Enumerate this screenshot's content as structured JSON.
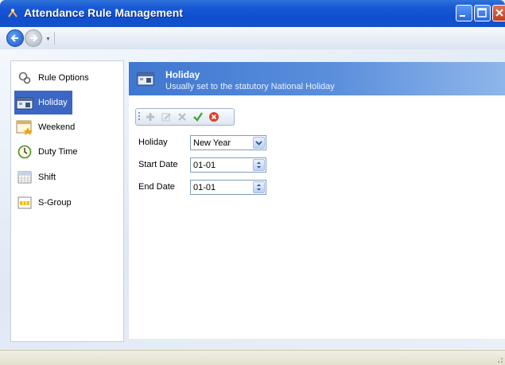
{
  "window": {
    "title": "Attendance Rule Management"
  },
  "nav": {
    "items": [
      {
        "label": "Rule Options",
        "icon": "gears-icon",
        "active": false
      },
      {
        "label": "Holiday",
        "icon": "holiday-calendar-icon",
        "active": true
      },
      {
        "label": "Weekend",
        "icon": "weekend-calendar-icon",
        "active": false
      },
      {
        "label": "Duty Time",
        "icon": "clock-icon",
        "active": false
      },
      {
        "label": "Shift",
        "icon": "shift-grid-icon",
        "active": false
      },
      {
        "label": "S-Group",
        "icon": "group-grid-icon",
        "active": false
      }
    ]
  },
  "panel": {
    "title": "Holiday",
    "subtitle": "Usually set to the statutory National Holiday"
  },
  "toolbar": {
    "buttons": [
      "add-icon",
      "edit-icon",
      "delete-icon",
      "save-check-icon",
      "cancel-icon"
    ]
  },
  "form": {
    "holiday_label": "Holiday",
    "holiday_value": "New Year",
    "start_label": "Start Date",
    "start_value": "01-01",
    "end_label": "End Date",
    "end_value": "01-01"
  },
  "colors": {
    "accent": "#3b66c4",
    "titlebar": "#0e4fd0",
    "header": "#3f77d0"
  }
}
